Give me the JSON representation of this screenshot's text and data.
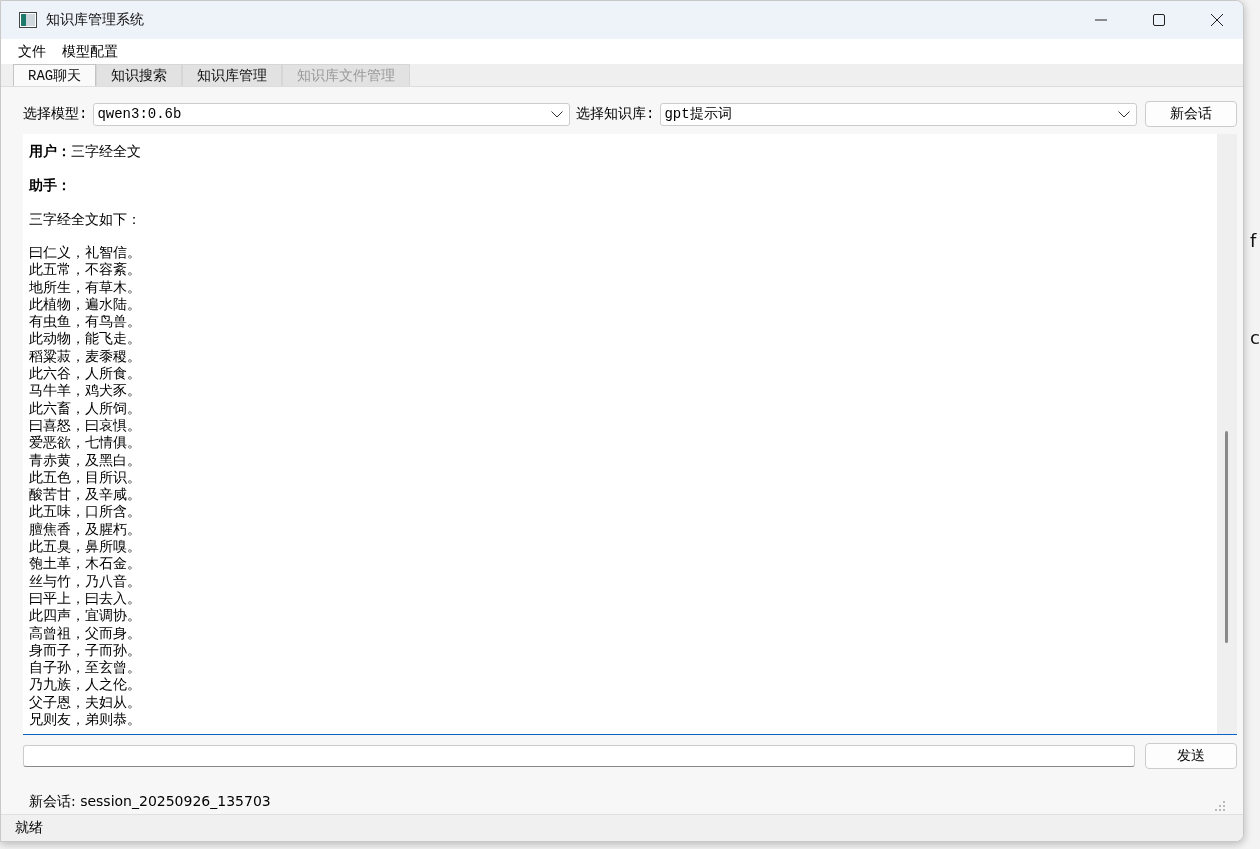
{
  "window": {
    "title": "知识库管理系统"
  },
  "menu": [
    "文件",
    "模型配置"
  ],
  "tabs": [
    {
      "label": "RAG聊天",
      "selected": true,
      "disabled": false
    },
    {
      "label": "知识搜索",
      "selected": false,
      "disabled": false
    },
    {
      "label": "知识库管理",
      "selected": false,
      "disabled": false
    },
    {
      "label": "知识库文件管理",
      "selected": false,
      "disabled": true
    }
  ],
  "controls": {
    "model_label": "选择模型:",
    "model_value": "qwen3:0.6b",
    "kb_label": "选择知识库:",
    "kb_value": "gpt提示词",
    "new_session_button": "新会话"
  },
  "chat": {
    "messages": [
      {
        "kind": "user",
        "label": "用户：",
        "text": "三字经全文"
      },
      {
        "kind": "assistant",
        "label": "助手："
      }
    ],
    "intro": "三字经全文如下：",
    "lines": [
      "曰仁义，礼智信。",
      "此五常，不容紊。",
      "地所生，有草木。",
      "此植物，遍水陆。",
      "有虫鱼，有鸟兽。",
      "此动物，能飞走。",
      "稻粱菽，麦黍稷。",
      "此六谷，人所食。",
      "马牛羊，鸡犬豕。",
      "此六畜，人所饲。",
      "曰喜怒，曰哀惧。",
      "爱恶欲，七情俱。",
      "青赤黄，及黑白。",
      "此五色，目所识。",
      "酸苦甘，及辛咸。",
      "此五味，口所含。",
      "膻焦香，及腥朽。",
      "此五臭，鼻所嗅。",
      "匏土革，木石金。",
      "丝与竹，乃八音。",
      "曰平上，曰去入。",
      "此四声，宜调协。",
      "高曾祖，父而身。",
      "身而子，子而孙。",
      "自子孙，至玄曾。",
      "乃九族，人之伦。",
      "父子恩，夫妇从。",
      "兄则友，弟则恭。"
    ]
  },
  "send_button": "发送",
  "session_label": "新会话: session_20250926_135703",
  "status_bar": "就绪",
  "background": {
    "letters": [
      "f",
      "c"
    ]
  }
}
